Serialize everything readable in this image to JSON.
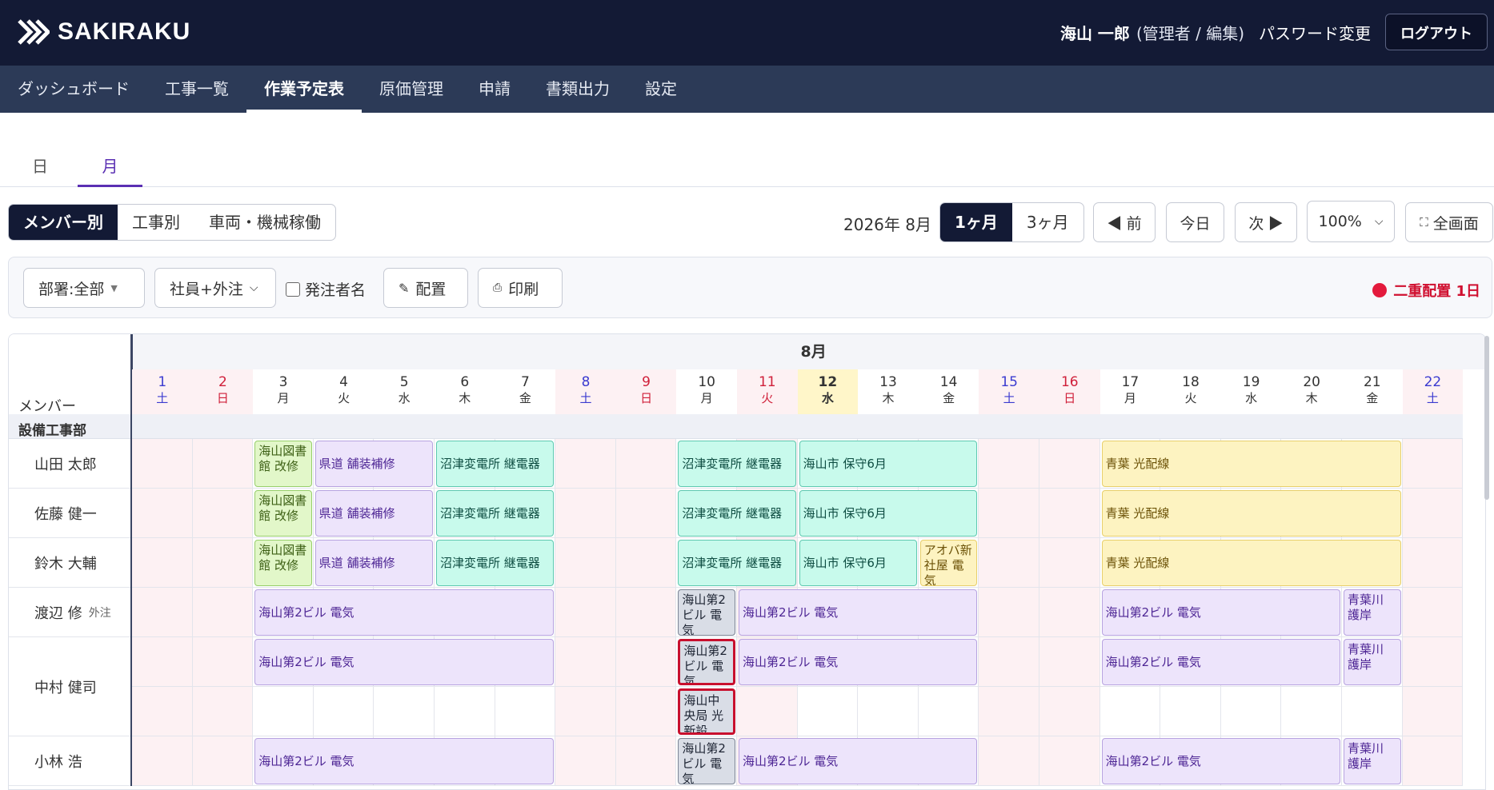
{
  "header": {
    "logo_text": "SAKIRAKU",
    "user_name": "海山 一郎",
    "user_role": "(管理者 / 編集)",
    "password_link": "パスワード変更",
    "logout_label": "ログアウト"
  },
  "nav": [
    "ダッシュボード",
    "工事一覧",
    "作業予定表",
    "原価管理",
    "申請",
    "書類出力",
    "設定"
  ],
  "view_tabs": [
    "日",
    "月"
  ],
  "group_by": [
    "メンバー別",
    "工事別",
    "車両・機械稼働"
  ],
  "period": {
    "label": "2026年 8月",
    "ranges": [
      "1ヶ月",
      "3ヶ月"
    ],
    "prev": "◀ 前",
    "today": "今日",
    "next": "次 ▶",
    "zoom": "100%",
    "fullscreen": "全画面"
  },
  "filters": {
    "department": "部署:全部",
    "staff_type": "社員+外注",
    "orderer_label": "発注者名",
    "assign_label": "配置",
    "print_label": "印刷",
    "duplicate_label": "二重配置 1日"
  },
  "calendar": {
    "month_label": "8月",
    "member_header": "メンバー",
    "department": "設備工事部",
    "days": [
      {
        "d": "1",
        "w": "土",
        "t": "sat"
      },
      {
        "d": "2",
        "w": "日",
        "t": "sun"
      },
      {
        "d": "3",
        "w": "月",
        "t": "wk"
      },
      {
        "d": "4",
        "w": "火",
        "t": "wk"
      },
      {
        "d": "5",
        "w": "水",
        "t": "wk"
      },
      {
        "d": "6",
        "w": "木",
        "t": "wk"
      },
      {
        "d": "7",
        "w": "金",
        "t": "wk"
      },
      {
        "d": "8",
        "w": "土",
        "t": "sat"
      },
      {
        "d": "9",
        "w": "日",
        "t": "sun"
      },
      {
        "d": "10",
        "w": "月",
        "t": "wk"
      },
      {
        "d": "11",
        "w": "火",
        "t": "hol"
      },
      {
        "d": "12",
        "w": "水",
        "t": "today"
      },
      {
        "d": "13",
        "w": "木",
        "t": "wk"
      },
      {
        "d": "14",
        "w": "金",
        "t": "wk"
      },
      {
        "d": "15",
        "w": "土",
        "t": "sat"
      },
      {
        "d": "16",
        "w": "日",
        "t": "sun"
      },
      {
        "d": "17",
        "w": "月",
        "t": "wk"
      },
      {
        "d": "18",
        "w": "火",
        "t": "wk"
      },
      {
        "d": "19",
        "w": "水",
        "t": "wk"
      },
      {
        "d": "20",
        "w": "木",
        "t": "wk"
      },
      {
        "d": "21",
        "w": "金",
        "t": "wk"
      },
      {
        "d": "22",
        "w": "土",
        "t": "sat"
      }
    ],
    "members": [
      {
        "name": "山田 太郎",
        "tag": "",
        "rows": 1
      },
      {
        "name": "佐藤 健一",
        "tag": "",
        "rows": 1
      },
      {
        "name": "鈴木 大輔",
        "tag": "",
        "rows": 1
      },
      {
        "name": "渡辺 修",
        "tag": "外注",
        "rows": 1
      },
      {
        "name": "中村 健司",
        "tag": "",
        "rows": 2
      },
      {
        "name": "小林 浩",
        "tag": "",
        "rows": 1
      }
    ],
    "jobs": [
      {
        "row": 0,
        "start": 3,
        "end": 3,
        "label": "海山図書館 改修",
        "color": "green"
      },
      {
        "row": 0,
        "start": 4,
        "end": 5,
        "label": "県道 舗装補修",
        "color": "purple"
      },
      {
        "row": 0,
        "start": 6,
        "end": 7,
        "label": "沼津変電所 継電器",
        "color": "teal"
      },
      {
        "row": 0,
        "start": 10,
        "end": 11,
        "label": "沼津変電所 継電器",
        "color": "teal"
      },
      {
        "row": 0,
        "start": 12,
        "end": 14,
        "label": "海山市 保守6月",
        "color": "teal"
      },
      {
        "row": 0,
        "start": 17,
        "end": 21,
        "label": "青葉 光配線",
        "color": "yellow"
      },
      {
        "row": 1,
        "start": 3,
        "end": 3,
        "label": "海山図書館 改修",
        "color": "green"
      },
      {
        "row": 1,
        "start": 4,
        "end": 5,
        "label": "県道 舗装補修",
        "color": "purple"
      },
      {
        "row": 1,
        "start": 6,
        "end": 7,
        "label": "沼津変電所 継電器",
        "color": "teal"
      },
      {
        "row": 1,
        "start": 10,
        "end": 11,
        "label": "沼津変電所 継電器",
        "color": "teal"
      },
      {
        "row": 1,
        "start": 12,
        "end": 14,
        "label": "海山市 保守6月",
        "color": "teal"
      },
      {
        "row": 1,
        "start": 17,
        "end": 21,
        "label": "青葉 光配線",
        "color": "yellow"
      },
      {
        "row": 2,
        "start": 3,
        "end": 3,
        "label": "海山図書館 改修",
        "color": "green"
      },
      {
        "row": 2,
        "start": 4,
        "end": 5,
        "label": "県道 舗装補修",
        "color": "purple"
      },
      {
        "row": 2,
        "start": 6,
        "end": 7,
        "label": "沼津変電所 継電器",
        "color": "teal"
      },
      {
        "row": 2,
        "start": 10,
        "end": 11,
        "label": "沼津変電所 継電器",
        "color": "teal"
      },
      {
        "row": 2,
        "start": 12,
        "end": 13,
        "label": "海山市 保守6月",
        "color": "teal"
      },
      {
        "row": 2,
        "start": 14,
        "end": 14,
        "label": "アオバ新社屋 電気",
        "color": "yellow"
      },
      {
        "row": 2,
        "start": 17,
        "end": 21,
        "label": "青葉 光配線",
        "color": "yellow"
      },
      {
        "row": 3,
        "start": 3,
        "end": 7,
        "label": "海山第2ビル 電気",
        "color": "purple"
      },
      {
        "row": 3,
        "start": 10,
        "end": 10,
        "label": "海山第2ビル 電気",
        "color": "gray"
      },
      {
        "row": 3,
        "start": 11,
        "end": 14,
        "label": "海山第2ビル 電気",
        "color": "purple"
      },
      {
        "row": 3,
        "start": 17,
        "end": 20,
        "label": "海山第2ビル 電気",
        "color": "purple"
      },
      {
        "row": 3,
        "start": 21,
        "end": 21,
        "label": "青葉川 護岸",
        "color": "purple"
      },
      {
        "row": 4,
        "start": 3,
        "end": 7,
        "label": "海山第2ビル 電気",
        "color": "purple"
      },
      {
        "row": 4,
        "start": 10,
        "end": 10,
        "label": "海山第2ビル 電気",
        "color": "gray",
        "dup": true
      },
      {
        "row": 4,
        "start": 11,
        "end": 14,
        "label": "海山第2ビル 電気",
        "color": "purple"
      },
      {
        "row": 4,
        "start": 17,
        "end": 20,
        "label": "海山第2ビル 電気",
        "color": "purple"
      },
      {
        "row": 4,
        "start": 21,
        "end": 21,
        "label": "青葉川 護岸",
        "color": "purple"
      },
      {
        "row": 5,
        "start": 10,
        "end": 10,
        "label": "海山中央局 光新設",
        "color": "gray",
        "dup": true
      },
      {
        "row": 6,
        "start": 3,
        "end": 7,
        "label": "海山第2ビル 電気",
        "color": "purple"
      },
      {
        "row": 6,
        "start": 10,
        "end": 10,
        "label": "海山第2ビル 電気",
        "color": "gray"
      },
      {
        "row": 6,
        "start": 11,
        "end": 14,
        "label": "海山第2ビル 電気",
        "color": "purple"
      },
      {
        "row": 6,
        "start": 17,
        "end": 20,
        "label": "海山第2ビル 電気",
        "color": "purple"
      },
      {
        "row": 6,
        "start": 21,
        "end": 21,
        "label": "青葉川 護岸",
        "color": "purple"
      }
    ]
  },
  "colors": {
    "sat": "#3b3bd0",
    "sun": "#d0203a",
    "hol": "#d0203a",
    "today_bg": "#fff6c9",
    "weekend_bg": "#fdf1f3"
  }
}
